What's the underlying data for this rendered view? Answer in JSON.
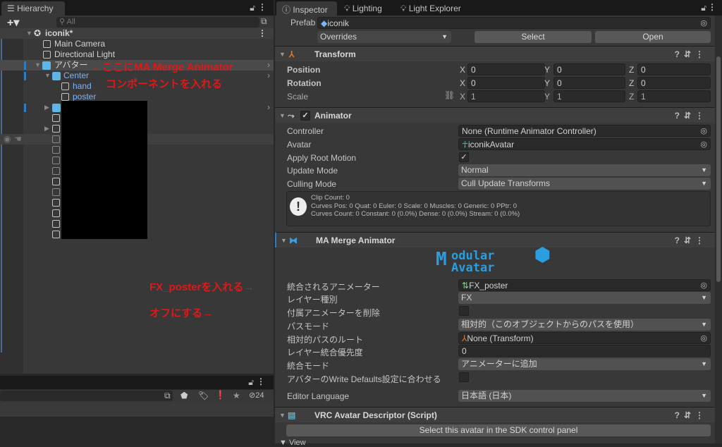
{
  "hierarchy": {
    "tab": "Hierarchy",
    "search_placeholder": "All",
    "root": "iconik*",
    "items": [
      "Main Camera",
      "Directional Light",
      "アバター",
      "Center",
      "hand",
      "poster"
    ]
  },
  "annotations": {
    "a1": "←ここにMA Merge Animator",
    "a2": "コンポーネントを入れる",
    "a3": "FX_posterを入れる→",
    "a4": "オフにする→"
  },
  "project": {
    "hidden_count": "24"
  },
  "inspector": {
    "tabs": [
      "Inspector",
      "Lighting",
      "Light Explorer"
    ],
    "prefab_label": "Prefab",
    "prefab_value": "iconik",
    "overrides": "Overrides",
    "select": "Select",
    "open": "Open",
    "transform": {
      "title": "Transform",
      "rows": [
        {
          "label": "Position",
          "x": "0",
          "y": "0",
          "z": "0"
        },
        {
          "label": "Rotation",
          "x": "0",
          "y": "0",
          "z": "0"
        },
        {
          "label": "Scale",
          "x": "1",
          "y": "1",
          "z": "1"
        }
      ],
      "axes": [
        "X",
        "Y",
        "Z"
      ]
    },
    "animator": {
      "title": "Animator",
      "enabled": true,
      "fields": [
        {
          "label": "Controller",
          "value": "None (Runtime Animator Controller)"
        },
        {
          "label": "Avatar",
          "value": "iconikAvatar"
        },
        {
          "label": "Apply Root Motion",
          "value": true
        },
        {
          "label": "Update Mode",
          "value": "Normal"
        },
        {
          "label": "Culling Mode",
          "value": "Cull Update Transforms"
        }
      ],
      "info": [
        "Clip Count: 0",
        "Curves Pos: 0 Quat: 0 Euler: 0 Scale: 0 Muscles: 0 Generic: 0 PPtr: 0",
        "Curves Count: 0 Constant: 0 (0.0%) Dense: 0 (0.0%) Stream: 0 (0.0%)"
      ]
    },
    "merge": {
      "title": "MA Merge Animator",
      "logo": "Modular Avatar",
      "fields": [
        {
          "label": "統合されるアニメーター",
          "value": "FX_poster"
        },
        {
          "label": "レイヤー種別",
          "value": "FX"
        },
        {
          "label": "付属アニメーターを削除",
          "value": false
        },
        {
          "label": "パスモード",
          "value": "相対的（このオブジェクトからのパスを使用）"
        },
        {
          "label": "相対的パスのルート",
          "value": "None (Transform)"
        },
        {
          "label": "レイヤー統合優先度",
          "value": "0"
        },
        {
          "label": "統合モード",
          "value": "アニメーターに追加"
        },
        {
          "label": "アバターのWrite Defaults設定に合わせる",
          "value": false
        }
      ],
      "editor_language_label": "Editor Language",
      "editor_language": "日本語 (日本)"
    },
    "vrc": {
      "title": "VRC Avatar Descriptor (Script)",
      "button": "Select this avatar in the SDK control panel",
      "view": "View"
    }
  }
}
